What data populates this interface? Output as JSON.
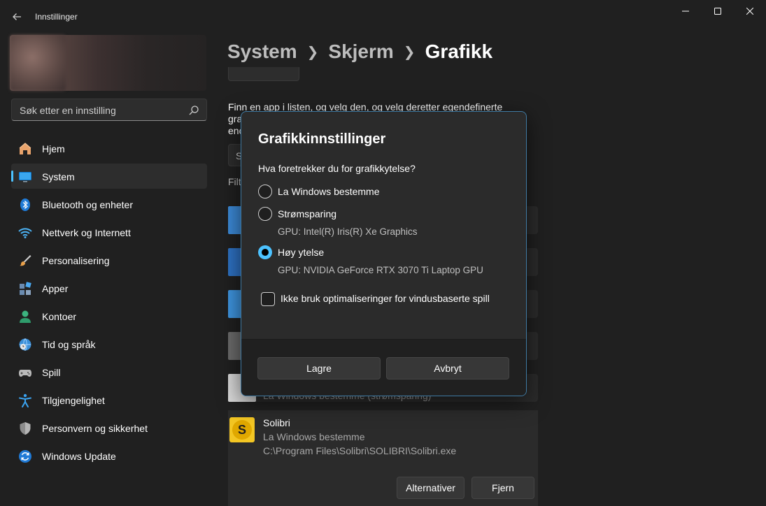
{
  "window": {
    "title": "Innstillinger",
    "minimize_label": "",
    "maximize_label": "",
    "close_label": ""
  },
  "sidebar": {
    "search_placeholder": "Søk etter en innstilling",
    "items": [
      {
        "label": "Hjem",
        "icon": "home-icon"
      },
      {
        "label": "System",
        "icon": "display-icon",
        "active": true
      },
      {
        "label": "Bluetooth og enheter",
        "icon": "bluetooth-icon"
      },
      {
        "label": "Nettverk og Internett",
        "icon": "wifi-icon"
      },
      {
        "label": "Personalisering",
        "icon": "brush-icon"
      },
      {
        "label": "Apper",
        "icon": "apps-icon"
      },
      {
        "label": "Kontoer",
        "icon": "person-icon"
      },
      {
        "label": "Tid og språk",
        "icon": "globe-clock-icon"
      },
      {
        "label": "Spill",
        "icon": "gamepad-icon"
      },
      {
        "label": "Tilgjengelighet",
        "icon": "accessibility-icon"
      },
      {
        "label": "Personvern og sikkerhet",
        "icon": "shield-icon"
      },
      {
        "label": "Windows Update",
        "icon": "update-icon"
      }
    ]
  },
  "breadcrumb": {
    "parts": [
      "System",
      "Skjerm"
    ],
    "current": "Grafikk"
  },
  "main": {
    "description_line1": "Finn en app i listen, og velg den, og velg deretter egendefinerte",
    "description_line2": "gra",
    "description_line3": "enc",
    "app_search_text": "S",
    "filter_label": "Filt",
    "row_subtext": "La Windows bestemme (strømsparing)",
    "solibri": {
      "name": "Solibri",
      "preference": "La Windows bestemme",
      "path": "C:\\Program Files\\Solibri\\SOLIBRI\\Solibri.exe",
      "options_label": "Alternativer",
      "remove_label": "Fjern",
      "icon_letter": "S"
    }
  },
  "dialog": {
    "title": "Grafikkinnstillinger",
    "question": "Hva foretrekker du for grafikkytelse?",
    "options": [
      {
        "label": "La Windows bestemme",
        "sub": "",
        "checked": false
      },
      {
        "label": "Strømsparing",
        "sub": "GPU: Intel(R) Iris(R) Xe Graphics",
        "checked": false
      },
      {
        "label": "Høy ytelse",
        "sub": "GPU: NVIDIA GeForce RTX 3070 Ti Laptop GPU",
        "checked": true
      }
    ],
    "checkbox_label": "Ikke bruk optimaliseringer for vindusbaserte spill",
    "checkbox_checked": false,
    "save_label": "Lagre",
    "cancel_label": "Avbryt"
  },
  "colors": {
    "accent": "#4cc2ff",
    "background": "#202020",
    "card": "#2b2b2b"
  }
}
